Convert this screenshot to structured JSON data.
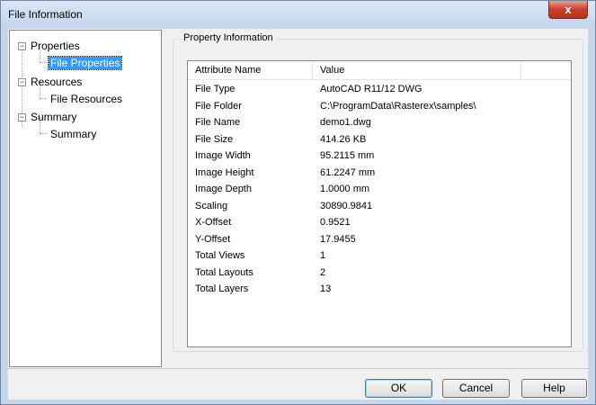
{
  "window": {
    "title": "File Information",
    "close_label": "x"
  },
  "tree": {
    "nodes": [
      {
        "label": "Properties",
        "toggle": "−",
        "children": [
          {
            "label": "File Properties",
            "selected": true
          }
        ]
      },
      {
        "label": "Resources",
        "toggle": "−",
        "children": [
          {
            "label": "File Resources"
          }
        ]
      },
      {
        "label": "Summary",
        "toggle": "−",
        "children": [
          {
            "label": "Summary"
          }
        ]
      }
    ]
  },
  "panel": {
    "group_label": "Property Information",
    "columns": [
      "Attribute Name",
      "Value"
    ],
    "rows": [
      [
        "File Type",
        "AutoCAD R11/12 DWG"
      ],
      [
        "File Folder",
        "C:\\ProgramData\\Rasterex\\samples\\"
      ],
      [
        "File Name",
        "demo1.dwg"
      ],
      [
        "File Size",
        "414.26 KB"
      ],
      [
        "Image Width",
        "95.2115 mm"
      ],
      [
        "Image Height",
        "61.2247 mm"
      ],
      [
        "Image Depth",
        "1.0000 mm"
      ],
      [
        "Scaling",
        "30890.9841"
      ],
      [
        "X-Offset",
        "0.9521"
      ],
      [
        "Y-Offset",
        "17.9455"
      ],
      [
        "Total Views",
        "1"
      ],
      [
        "Total Layouts",
        "2"
      ],
      [
        "Total Layers",
        "13"
      ]
    ]
  },
  "buttons": {
    "ok": "OK",
    "cancel": "Cancel",
    "help": "Help"
  }
}
